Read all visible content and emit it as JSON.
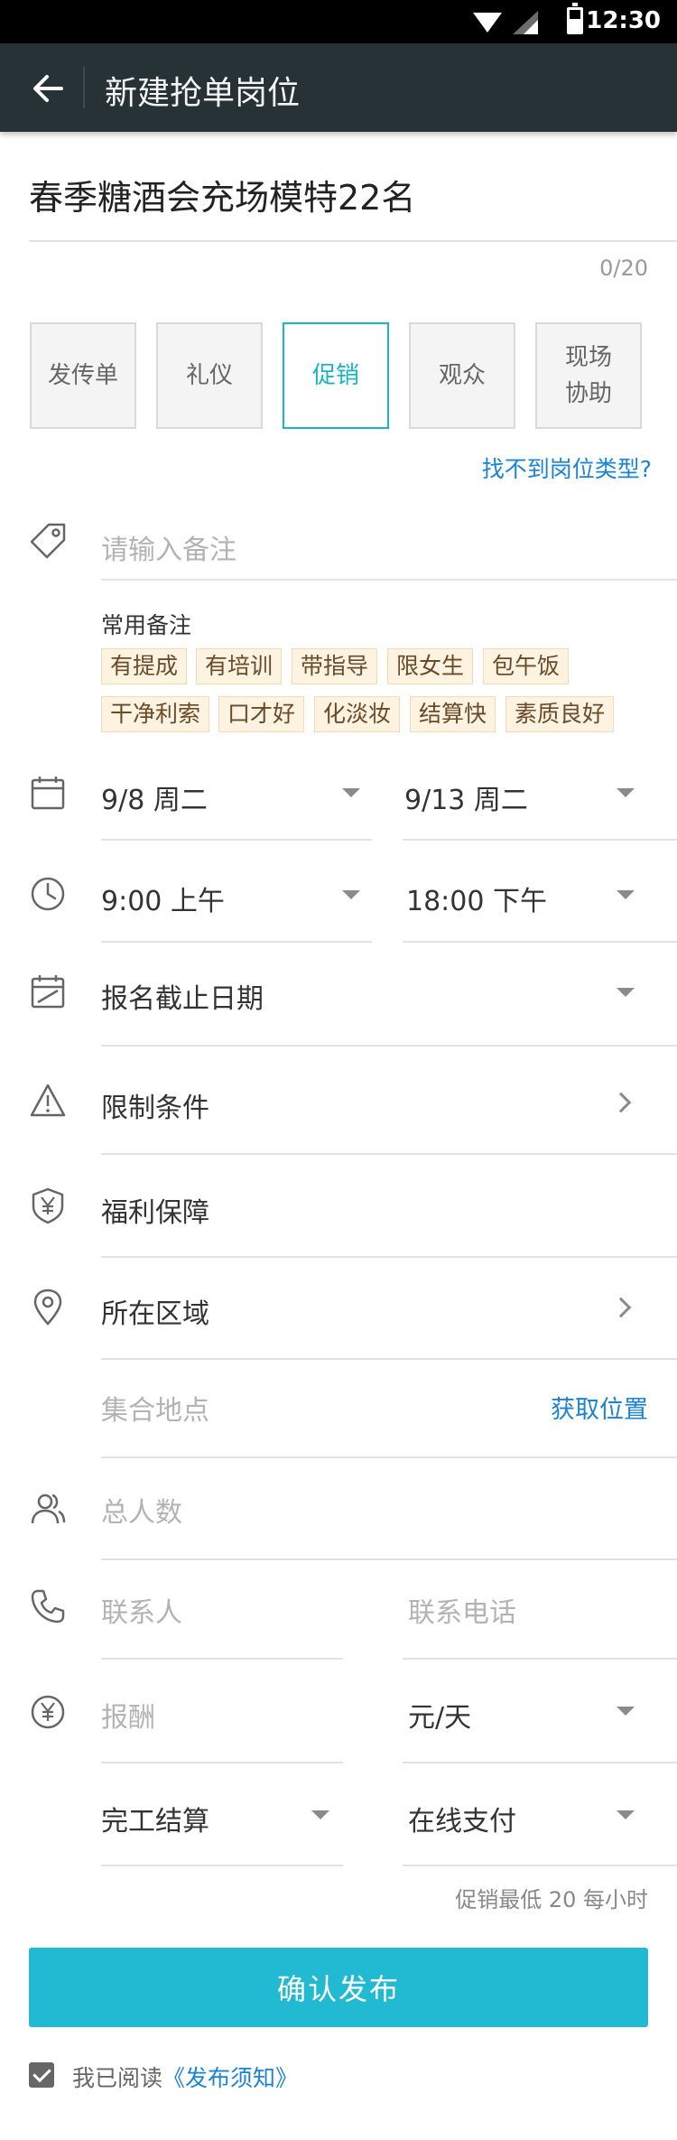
{
  "status_bar": {
    "time": "12:30"
  },
  "app_bar": {
    "title": "新建抢单岗位"
  },
  "headline": {
    "value": "春季糖酒会充场模特22名",
    "counter": "0/20"
  },
  "job_types": [
    {
      "label": "发传单"
    },
    {
      "label": "礼仪"
    },
    {
      "label": "促销"
    },
    {
      "label": "观众"
    },
    {
      "label": "现场\n协助"
    }
  ],
  "selected_type": "促销",
  "cant_find_link": "找不到岗位类型?",
  "remark": {
    "placeholder": "请输入备注"
  },
  "common_remarks": {
    "title": "常用备注",
    "tags": [
      "有提成",
      "有培训",
      "带指导",
      "限女生",
      "包午饭",
      "干净利索",
      "口才好",
      "化淡妆",
      "结算快",
      "素质良好"
    ]
  },
  "date": {
    "start": "9/8 周二",
    "end": "9/13 周二"
  },
  "time": {
    "start": "9:00 上午",
    "end": "18:00 下午"
  },
  "deadline": {
    "label": "报名截止日期"
  },
  "restrictions": {
    "label": "限制条件"
  },
  "benefits": {
    "label": "福利保障"
  },
  "area": {
    "label": "所在区域"
  },
  "meeting_point": {
    "placeholder": "集合地点",
    "action": "获取位置"
  },
  "headcount": {
    "placeholder": "总人数"
  },
  "contact": {
    "name_placeholder": "联系人",
    "phone_placeholder": "联系电话"
  },
  "pay": {
    "placeholder": "报酬",
    "unit": "元/天",
    "settlement": "完工结算",
    "method": "在线支付",
    "note": "促销最低 20 每小时"
  },
  "submit_label": "确认发布",
  "agreement": {
    "prefix": "我已阅读",
    "link": "《发布须知》",
    "checked": true
  },
  "colors": {
    "accent": "#22bad2",
    "app_bar": "#263236",
    "link": "#1b83d6",
    "tag_bg": "#fdf3e0"
  }
}
